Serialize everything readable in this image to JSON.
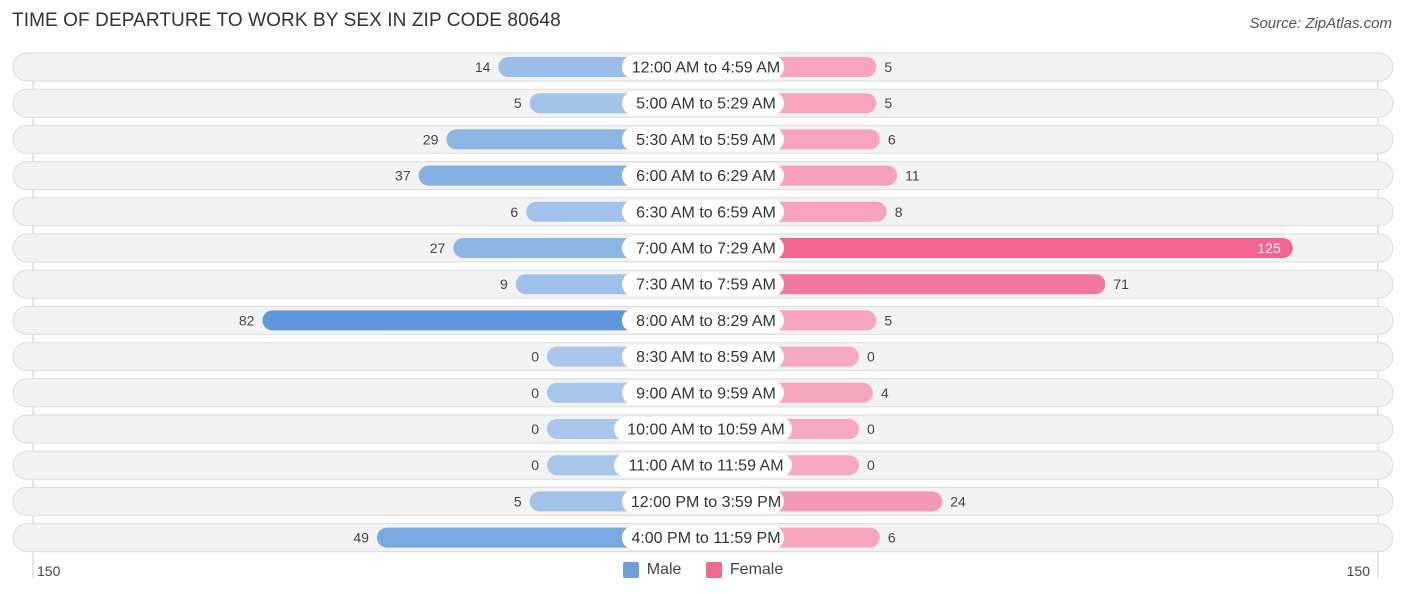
{
  "header": {
    "title": "TIME OF DEPARTURE TO WORK BY SEX IN ZIP CODE 80648",
    "source": "Source: ZipAtlas.com"
  },
  "axis": {
    "left_label": "150",
    "right_label": "150"
  },
  "legend": [
    {
      "name": "Male",
      "color": "#6a9fdc"
    },
    {
      "name": "Female",
      "color": "#f06a94"
    }
  ],
  "chart_data": {
    "type": "bar",
    "orientation": "horizontal-diverging",
    "title": "TIME OF DEPARTURE TO WORK BY SEX IN ZIP CODE 80648",
    "categories": [
      "12:00 AM to 4:59 AM",
      "5:00 AM to 5:29 AM",
      "5:30 AM to 5:59 AM",
      "6:00 AM to 6:29 AM",
      "6:30 AM to 6:59 AM",
      "7:00 AM to 7:29 AM",
      "7:30 AM to 7:59 AM",
      "8:00 AM to 8:29 AM",
      "8:30 AM to 8:59 AM",
      "9:00 AM to 9:59 AM",
      "10:00 AM to 10:59 AM",
      "11:00 AM to 11:59 AM",
      "12:00 PM to 3:59 PM",
      "4:00 PM to 11:59 PM"
    ],
    "series": [
      {
        "name": "Male",
        "values": [
          14,
          5,
          29,
          37,
          6,
          27,
          9,
          82,
          0,
          0,
          0,
          0,
          5,
          49
        ]
      },
      {
        "name": "Female",
        "values": [
          5,
          5,
          6,
          11,
          8,
          125,
          71,
          5,
          0,
          4,
          0,
          0,
          24,
          6
        ]
      }
    ],
    "xlim": [
      -150,
      150
    ],
    "legend_position": "bottom-center",
    "grid": false
  }
}
